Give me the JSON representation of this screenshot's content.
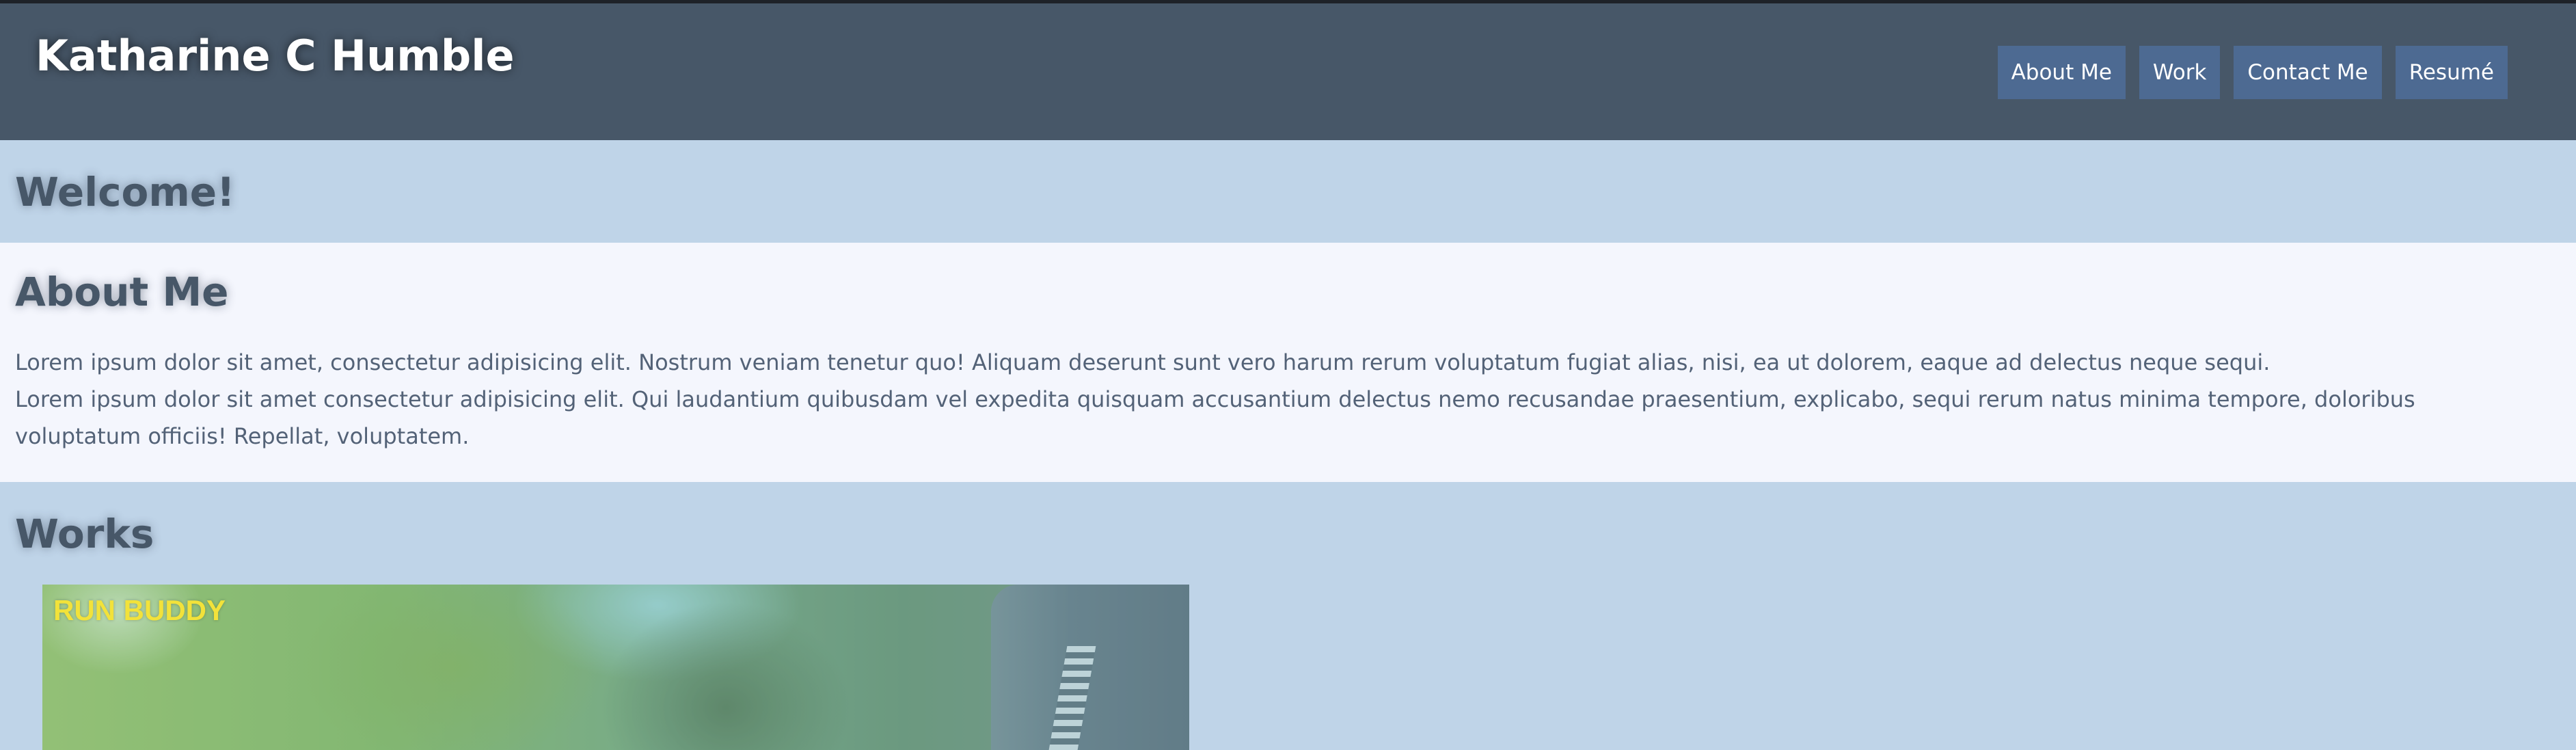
{
  "header": {
    "title": "Katharine C Humble",
    "nav": [
      {
        "label": "About Me"
      },
      {
        "label": "Work"
      },
      {
        "label": "Contact Me"
      },
      {
        "label": "Resumé"
      }
    ]
  },
  "welcome": {
    "heading": "Welcome!"
  },
  "about": {
    "heading": "About Me",
    "paragraphs": [
      "Lorem ipsum dolor sit amet, consectetur adipisicing elit. Nostrum veniam tenetur quo! Aliquam deserunt sunt vero harum rerum voluptatum fugiat alias, nisi, ea ut dolorem, eaque ad delectus neque sequi.",
      "Lorem ipsum dolor sit amet consectetur adipisicing elit. Qui laudantium quibusdam vel expedita quisquam accusantium delectus nemo recusandae praesentium, explicabo, sequi rerum natus minima tempore, doloribus voluptatum officiis! Repellat, voluptatem."
    ]
  },
  "works": {
    "heading": "Works",
    "items": [
      {
        "label": "RUN BUDDY"
      }
    ]
  },
  "colors": {
    "header_bg": "#475768",
    "nav_button_bg": "#4d6a92",
    "section_blue": "#bfd4e8",
    "section_light": "#f4f6fd",
    "heading_text": "#475768",
    "work_label": "#f2e23a"
  }
}
